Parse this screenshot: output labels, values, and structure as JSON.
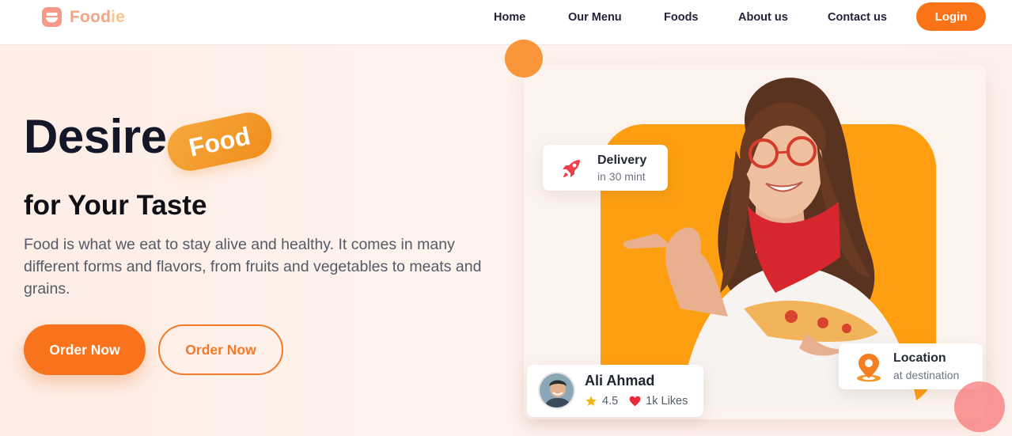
{
  "brand": {
    "name_part1": "Food",
    "name_part2": "ie",
    "logo_icon": "chef-bowl-icon",
    "colors": {
      "primary": "#fa7317",
      "logo": "#f4a585",
      "panel": "#fd9f11"
    }
  },
  "nav": {
    "items": [
      {
        "label": "Home"
      },
      {
        "label": "Our Menu"
      },
      {
        "label": "Foods"
      },
      {
        "label": "About us"
      },
      {
        "label": "Contact us"
      }
    ],
    "login_label": "Login"
  },
  "hero": {
    "headline": "Desire",
    "highlight": "Food",
    "subtitle": "for Your Taste",
    "description": "Food is what we eat to stay alive and healthy. It comes in many different forms and flavors, from fruits and vegetables to meats and grains.",
    "primary_cta": "Order Now",
    "secondary_cta": "Order Now"
  },
  "cards": {
    "delivery": {
      "icon": "rocket-icon",
      "title": "Delivery",
      "subtitle": "in 30 mint"
    },
    "location": {
      "icon": "location-pin-icon",
      "title": "Location",
      "subtitle": "at destination"
    },
    "profile": {
      "name": "Ali Ahmad",
      "rating": "4.5",
      "likes": "1k Likes",
      "rating_icon": "star-icon",
      "likes_icon": "heart-icon"
    }
  }
}
